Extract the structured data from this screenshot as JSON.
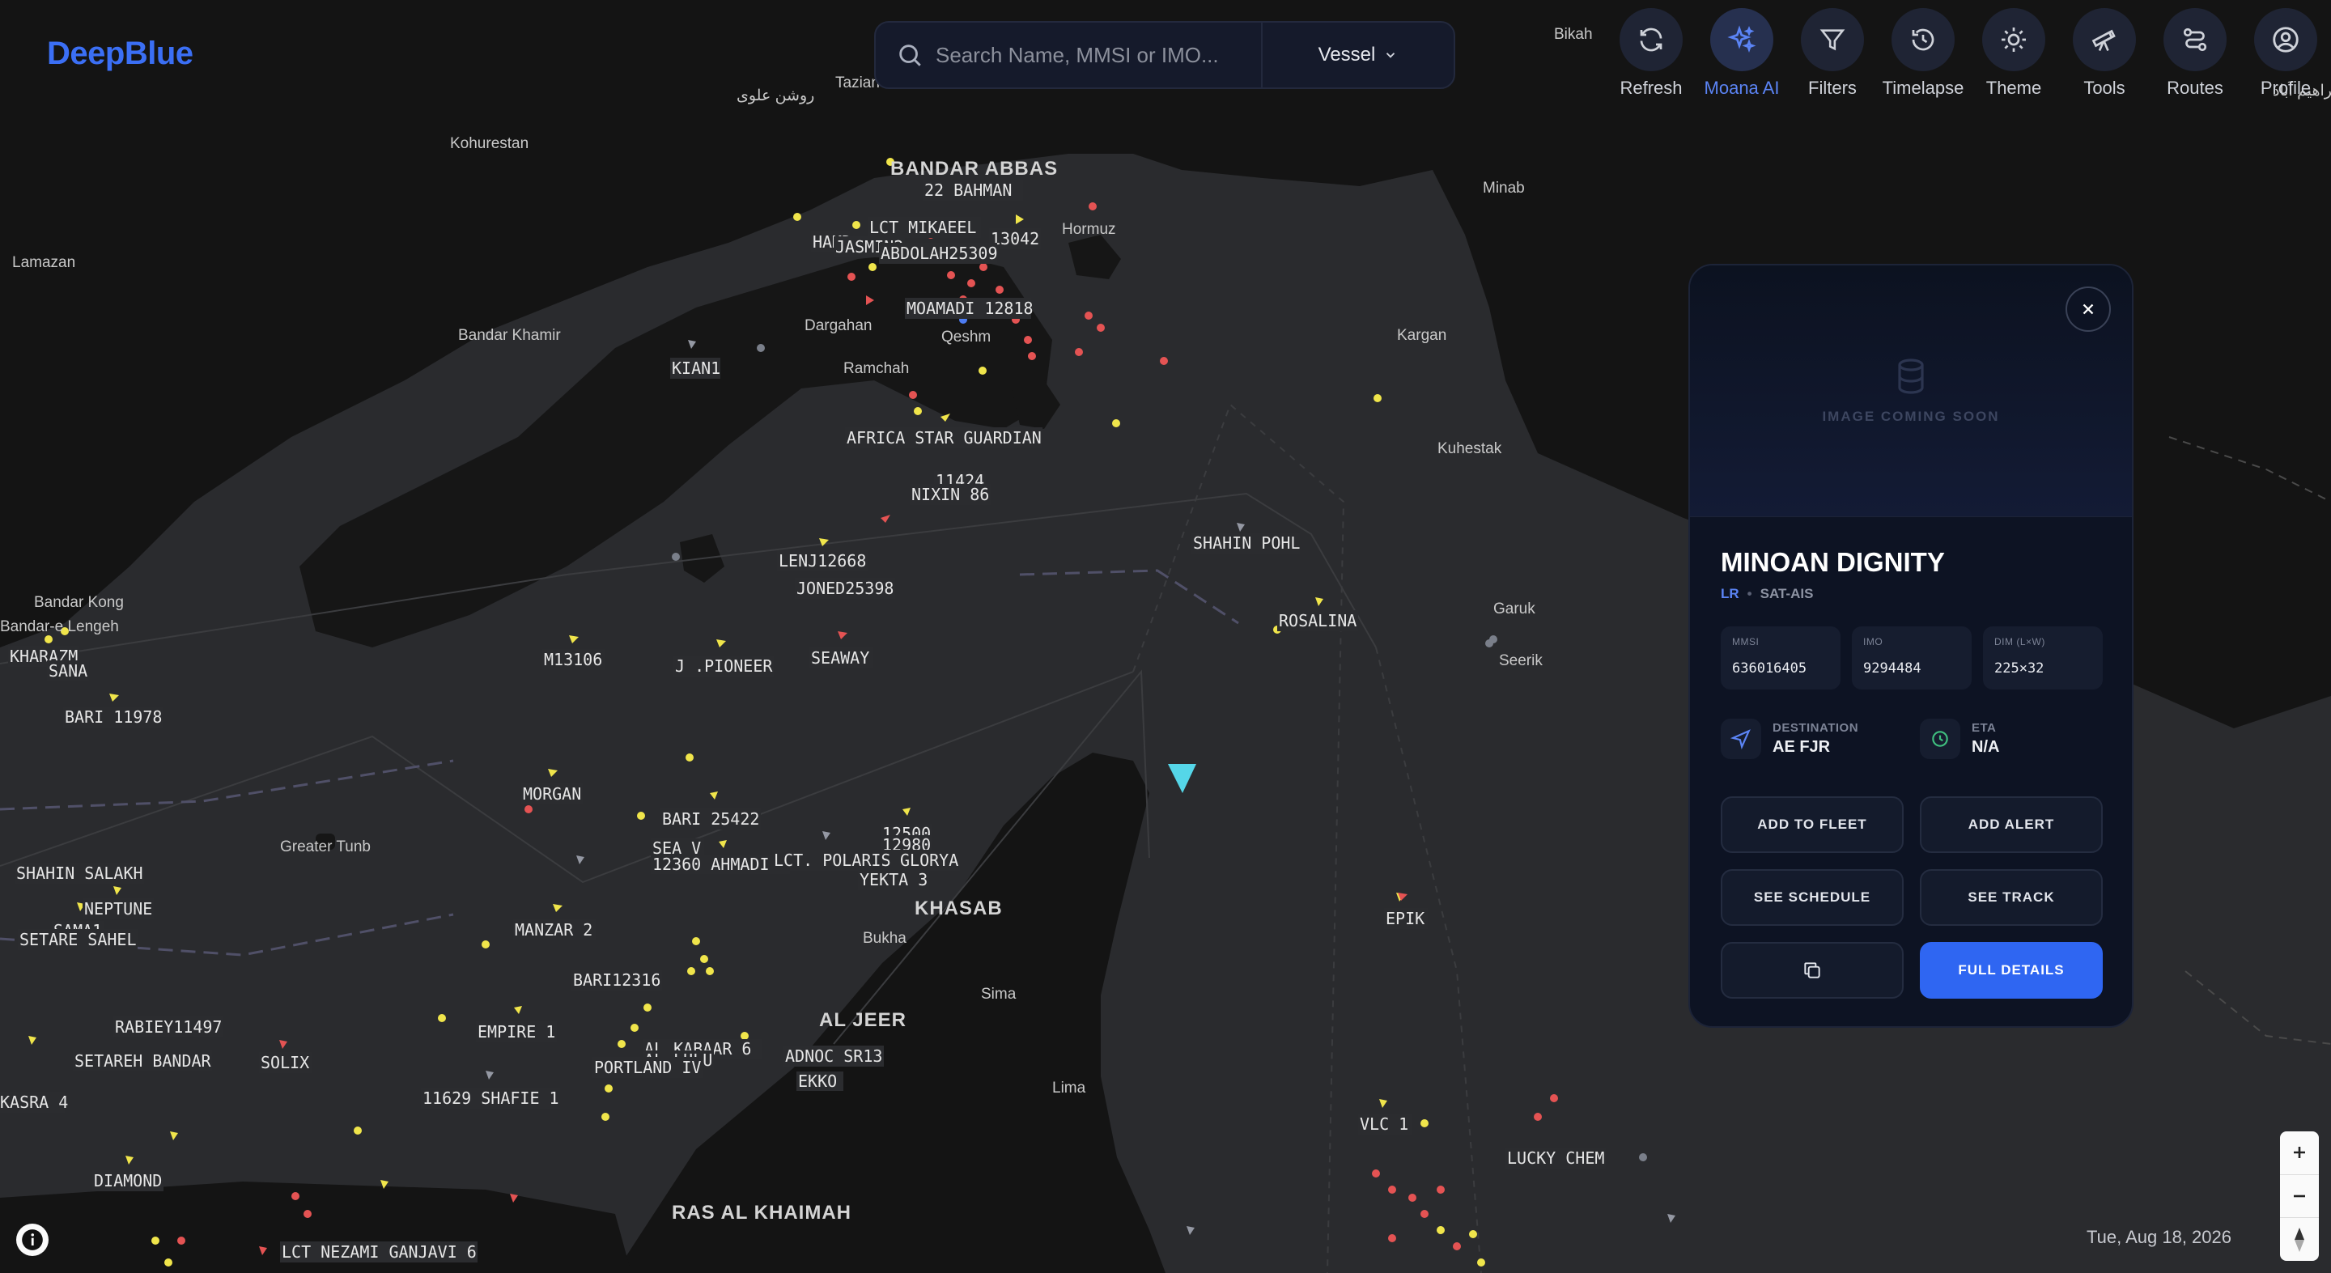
{
  "app": {
    "logo": "DeepBlue"
  },
  "search": {
    "placeholder": "Search Name, MMSI or IMO...",
    "type": "Vessel"
  },
  "toolbar": [
    {
      "label": "Refresh",
      "icon": "refresh-icon"
    },
    {
      "label": "Moana AI",
      "icon": "sparkles-icon",
      "active": true
    },
    {
      "label": "Filters",
      "icon": "filter-icon"
    },
    {
      "label": "Timelapse",
      "icon": "history-icon"
    },
    {
      "label": "Theme",
      "icon": "sun-icon"
    },
    {
      "label": "Tools",
      "icon": "telescope-icon"
    },
    {
      "label": "Routes",
      "icon": "route-icon"
    },
    {
      "label": "Profile",
      "icon": "user-circle-icon"
    }
  ],
  "map": {
    "places": [
      "Kohurestan",
      "Lamazan",
      "Bandar Khamir",
      "Dargahan",
      "Qeshm",
      "Ramchah",
      "Hormuz",
      "Minab",
      "Kargan",
      "Kuhestak",
      "Garuk",
      "Seerik",
      "Bandar Kong",
      "Bandar-e Lengeh",
      "Greater Tunb",
      "Bukha",
      "Sima",
      "Lima",
      "Bikah",
      "Tazian",
      "روشن علوی",
      "ابراهیم آباد"
    ],
    "big_places": [
      "BANDAR ABBAS",
      "KHASAB",
      "AL JEER",
      "RAS AL KHAIMAH"
    ],
    "vessels": [
      "22 BAHMAN",
      "LCT MIKAEEL",
      "HAMD",
      "JASMIN2",
      "13042",
      "ABDOLAH25309",
      "MOAMADI 12818",
      "KIAN1",
      "AFRICA STAR GUARDIAN",
      "11424",
      "NIXIN 86",
      "SHAHIN POHL",
      "LENJ12668",
      "JONED25398",
      "ROSALINA",
      "KHARAZM",
      "SANA",
      "M13106",
      "J .PIONEER",
      "SEAWAY",
      "BARI 11978",
      "MORGAN",
      "BARI 25422",
      "12500",
      "12980",
      "SEA V",
      "12360 AHMADI 1",
      "LCT. POLARIS",
      "GLORYA",
      "YEKTA 3",
      "SHAHIN SALAKH",
      "NEPTUNE",
      "SAMA1",
      "SETARE SAHEL",
      "MANZAR 2",
      "EPIK",
      "BARI12316",
      "RABIEY11497",
      "EMPIRE 1",
      "AL KABAAR 6",
      "AL LULU",
      "PORTLAND IV",
      "ADNOC SR13",
      "EKKO",
      "SETAREH BANDAR",
      "SOLIX",
      "KASRA 4",
      "11629 SHAFIE 1",
      "VLC 1",
      "LUCKY CHEM",
      "DIAMOND",
      "LCT NEZAMI GANJAVI 6"
    ]
  },
  "vessel_card": {
    "image_text": "IMAGE COMING SOON",
    "name": "MINOAN DIGNITY",
    "class": "LR",
    "source": "SAT-AIS",
    "fields": [
      {
        "key": "MMSI",
        "value": "636016405"
      },
      {
        "key": "IMO",
        "value": "9294484"
      },
      {
        "key": "DIM (L×W)",
        "value": "225×32"
      }
    ],
    "destination_label": "DESTINATION",
    "destination": "AE FJR",
    "eta_label": "ETA",
    "eta": "N/A",
    "buttons": {
      "add_fleet": "ADD TO FLEET",
      "add_alert": "ADD ALERT",
      "see_schedule": "SEE SCHEDULE",
      "see_track": "SEE TRACK",
      "full_details": "FULL DETAILS"
    },
    "accent_color": "#2f66f2",
    "eta_icon_color": "#3fbf7f"
  },
  "status": {
    "date": "Tue, Aug 18, 2026"
  }
}
